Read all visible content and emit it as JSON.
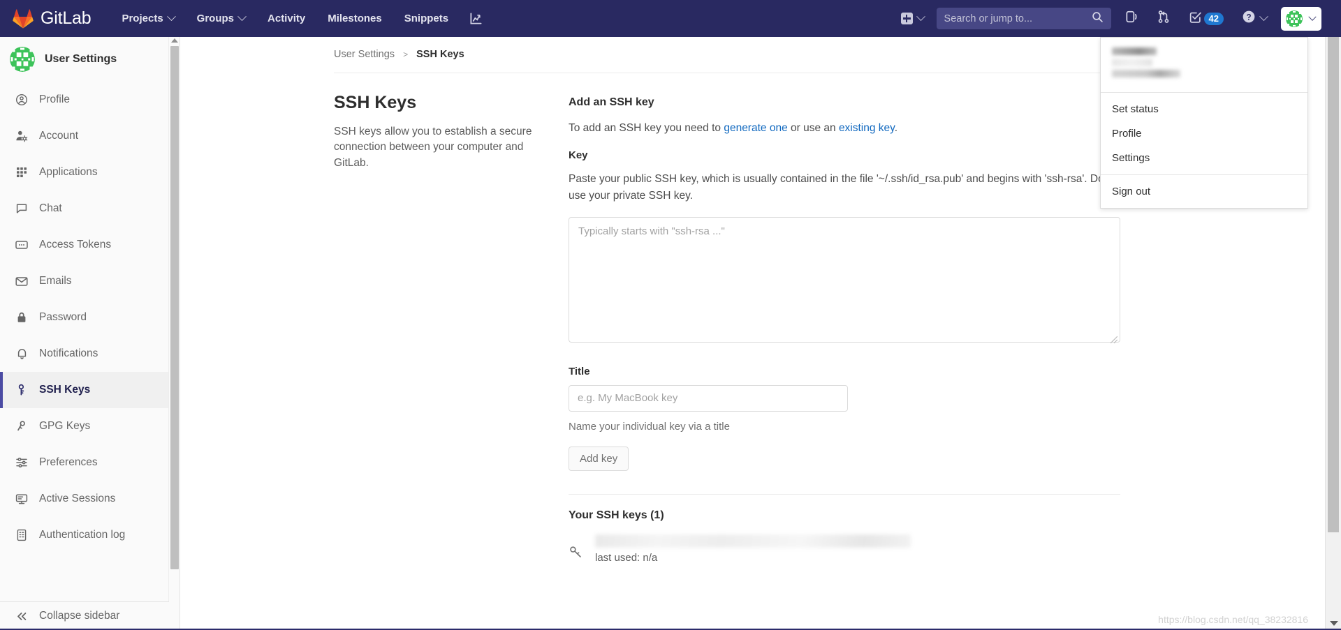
{
  "navbar": {
    "brand": "GitLab",
    "links": [
      {
        "label": "Projects",
        "has_caret": true
      },
      {
        "label": "Groups",
        "has_caret": true
      },
      {
        "label": "Activity",
        "has_caret": false
      },
      {
        "label": "Milestones",
        "has_caret": false
      },
      {
        "label": "Snippets",
        "has_caret": false
      }
    ],
    "analytics_icon": "chart-icon",
    "create_new_icon": "plus-square-icon",
    "search": {
      "placeholder": "Search or jump to...",
      "value": "",
      "icon": "search-icon"
    },
    "issues_icon": "issues-icon",
    "merge_requests_icon": "merge-request-icon",
    "todos": {
      "icon": "todo-check-icon",
      "count": "42"
    },
    "help": {
      "icon": "question-circle-icon"
    },
    "avatar": {
      "icon": "user-avatar-identicon",
      "color": "#3dc35a"
    }
  },
  "user_dropdown": {
    "name_redacted": "",
    "handle_redacted": "",
    "items": [
      {
        "label": "Set status"
      },
      {
        "label": "Profile"
      },
      {
        "label": "Settings"
      }
    ],
    "sign_out": {
      "label": "Sign out"
    }
  },
  "sidebar": {
    "header": {
      "title": "User Settings",
      "avatar_icon": "user-avatar-identicon"
    },
    "items": [
      {
        "label": "Profile",
        "icon": "user-circle-icon",
        "active": false
      },
      {
        "label": "Account",
        "icon": "user-gear-icon",
        "active": false
      },
      {
        "label": "Applications",
        "icon": "grid-apps-icon",
        "active": false
      },
      {
        "label": "Chat",
        "icon": "comment-icon",
        "active": false
      },
      {
        "label": "Access Tokens",
        "icon": "token-card-icon",
        "active": false
      },
      {
        "label": "Emails",
        "icon": "envelope-icon",
        "active": false
      },
      {
        "label": "Password",
        "icon": "lock-icon",
        "active": false
      },
      {
        "label": "Notifications",
        "icon": "bell-icon",
        "active": false
      },
      {
        "label": "SSH Keys",
        "icon": "key-icon",
        "active": true
      },
      {
        "label": "GPG Keys",
        "icon": "key-outline-icon",
        "active": false
      },
      {
        "label": "Preferences",
        "icon": "sliders-icon",
        "active": false
      },
      {
        "label": "Active Sessions",
        "icon": "monitor-icon",
        "active": false
      },
      {
        "label": "Authentication log",
        "icon": "log-list-icon",
        "active": false
      }
    ],
    "collapse": {
      "label": "Collapse sidebar",
      "icon": "double-chevron-left-icon"
    },
    "active_accent": "#4b4ba3"
  },
  "breadcrumb": {
    "parent": "User Settings",
    "separator": ">",
    "current": "SSH Keys"
  },
  "page": {
    "title": "SSH Keys",
    "description": "SSH keys allow you to establish a secure connection between your computer and GitLab."
  },
  "add_key": {
    "heading": "Add an SSH key",
    "intro_before": "To add an SSH key you need to ",
    "link_generate": "generate one",
    "intro_middle": " or use an ",
    "link_existing": "existing key",
    "intro_after": ".",
    "key_label": "Key",
    "key_help": "Paste your public SSH key, which is usually contained in the file '~/.ssh/id_rsa.pub' and begins with 'ssh-rsa'. Don't use your private SSH key.",
    "key_placeholder": "Typically starts with \"ssh-rsa ...\"",
    "key_value": "",
    "title_label": "Title",
    "title_placeholder": "e.g. My MacBook key",
    "title_value": "",
    "title_help": "Name your individual key via a title",
    "submit_label": "Add key"
  },
  "your_keys": {
    "heading": "Your SSH keys (1)",
    "rows": [
      {
        "title_redacted": "",
        "last_used": "last used: n/a",
        "icon": "key-icon"
      }
    ]
  },
  "watermark": {
    "text": "https://blog.csdn.net/qq_38232816"
  },
  "colors": {
    "navbar_bg": "#292961",
    "link_blue": "#1068bf",
    "badge_blue": "#1f78d1",
    "sidebar_bg": "#fafafa"
  }
}
